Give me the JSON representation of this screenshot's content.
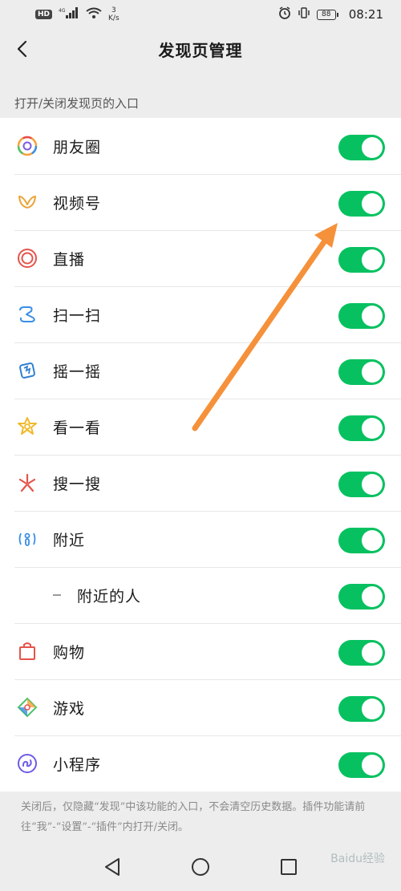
{
  "status_bar": {
    "hd": "HD",
    "signal": "4G",
    "net_speed_value": "3",
    "net_speed_unit": "K/s",
    "battery": "88",
    "time": "08:21"
  },
  "header": {
    "title": "发现页管理"
  },
  "section_label": "打开/关闭发现页的入口",
  "items": [
    {
      "label": "朋友圈",
      "enabled": true
    },
    {
      "label": "视频号",
      "enabled": true
    },
    {
      "label": "直播",
      "enabled": true
    },
    {
      "label": "扫一扫",
      "enabled": true
    },
    {
      "label": "摇一摇",
      "enabled": true
    },
    {
      "label": "看一看",
      "enabled": true
    },
    {
      "label": "搜一搜",
      "enabled": true
    },
    {
      "label": "附近",
      "enabled": true
    },
    {
      "label": "附近的人",
      "enabled": true
    },
    {
      "label": "购物",
      "enabled": true
    },
    {
      "label": "游戏",
      "enabled": true
    },
    {
      "label": "小程序",
      "enabled": true
    }
  ],
  "footer_note": "关闭后，仅隐藏“发现”中该功能的入口，不会清空历史数据。插件功能请前往“我”-“设置”-“插件”内打开/关闭。",
  "watermark": "Baidu经验",
  "colors": {
    "toggle_on": "#07c160",
    "annotation_arrow": "#f5913a"
  }
}
